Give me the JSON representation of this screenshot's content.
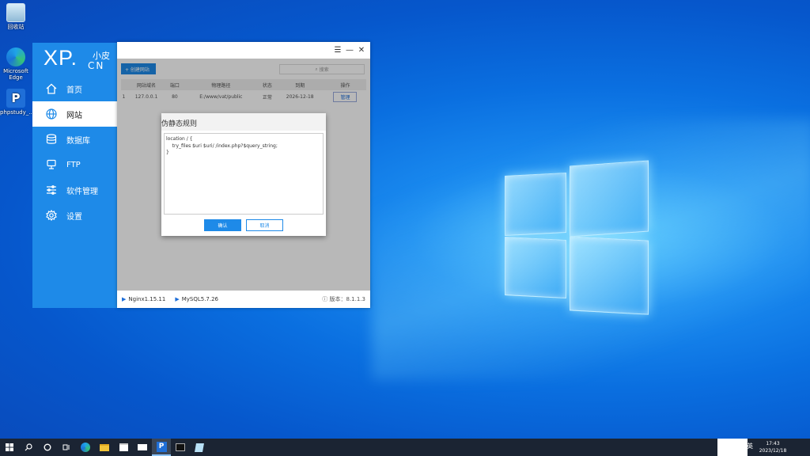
{
  "desktop": {
    "icons": [
      {
        "label": "回收站",
        "icon": "recycle-bin-icon"
      },
      {
        "label": "Microsoft Edge",
        "icon": "edge-icon"
      },
      {
        "label": "phpstudy_...",
        "icon": "phpstudy-icon"
      }
    ]
  },
  "app": {
    "brand": {
      "xp": "XP.",
      "xiaopi": "小皮",
      "cn": "CN"
    },
    "nav": [
      {
        "label": "首页",
        "icon": "home-icon"
      },
      {
        "label": "网站",
        "icon": "globe-icon"
      },
      {
        "label": "数据库",
        "icon": "database-icon"
      },
      {
        "label": "FTP",
        "icon": "ftp-icon"
      },
      {
        "label": "软件管理",
        "icon": "sliders-icon"
      },
      {
        "label": "设置",
        "icon": "gear-icon"
      }
    ],
    "active_nav": "网站",
    "window_controls": {
      "menu": "☰",
      "minimize": "—",
      "close": "✕"
    },
    "toolbar": {
      "create_label": "+ 创建网站",
      "search_placeholder": "搜索"
    },
    "table": {
      "headers": [
        "",
        "网站域名",
        "端口",
        "物理路径",
        "状态",
        "到期",
        "操作"
      ],
      "rows": [
        {
          "index": "1",
          "domain": "127.0.0.1",
          "port": "80",
          "path": "E:/www/vat/public",
          "status": "正常",
          "expiry": "2026-12-18",
          "action": "管理"
        }
      ]
    },
    "status_bar": {
      "nginx": "Nginx1.15.11",
      "mysql": "MySQL5.7.26",
      "version": "版本：8.1.1.3"
    }
  },
  "modal": {
    "title": "伪静态规则",
    "rules_text": "location / {\n    try_files $uri $uri/ /index.php?$query_string;\n}",
    "ok_label": "确认",
    "cancel_label": "取消"
  },
  "taskbar": {
    "lang": "英",
    "time": "17:43",
    "date": "2023/12/18"
  }
}
